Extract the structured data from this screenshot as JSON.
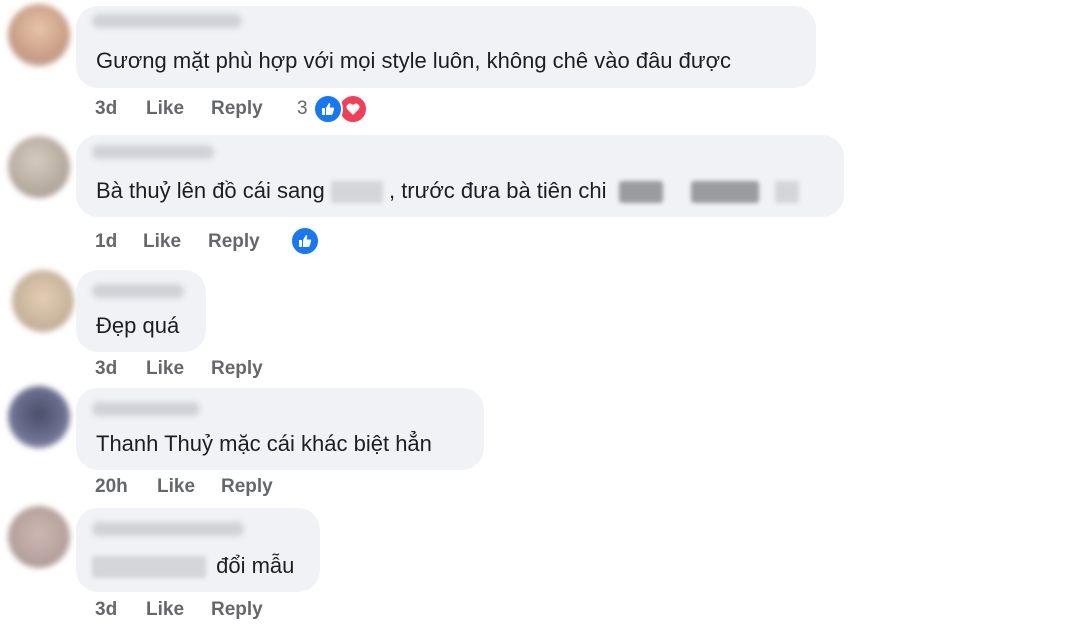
{
  "comments": [
    {
      "text": "Gương mặt phù hợp với mọi style luôn, không chê vào đâu được",
      "time": "3d",
      "like": "Like",
      "reply": "Reply",
      "reaction_count": "3",
      "reactions": [
        "like-icon",
        "love-icon"
      ]
    },
    {
      "text_a": "Bà thuỷ lên đồ cái sang",
      "text_b": ", trước đưa bà tiên chi",
      "time": "1d",
      "like": "Like",
      "reply": "Reply",
      "reactions": [
        "like-icon"
      ]
    },
    {
      "text": "Đẹp quá",
      "time": "3d",
      "like": "Like",
      "reply": "Reply"
    },
    {
      "text": "Thanh Thuỷ mặc cái khác biệt hẳn",
      "time": "20h",
      "like": "Like",
      "reply": "Reply"
    },
    {
      "text_b": "đổi mẫu",
      "time": "3d",
      "like": "Like",
      "reply": "Reply"
    }
  ],
  "colors": {
    "bubble": "#f0f2f5",
    "meta_text": "#65676b",
    "like_blue": "#1877f2",
    "love_red": "#f33e58"
  }
}
